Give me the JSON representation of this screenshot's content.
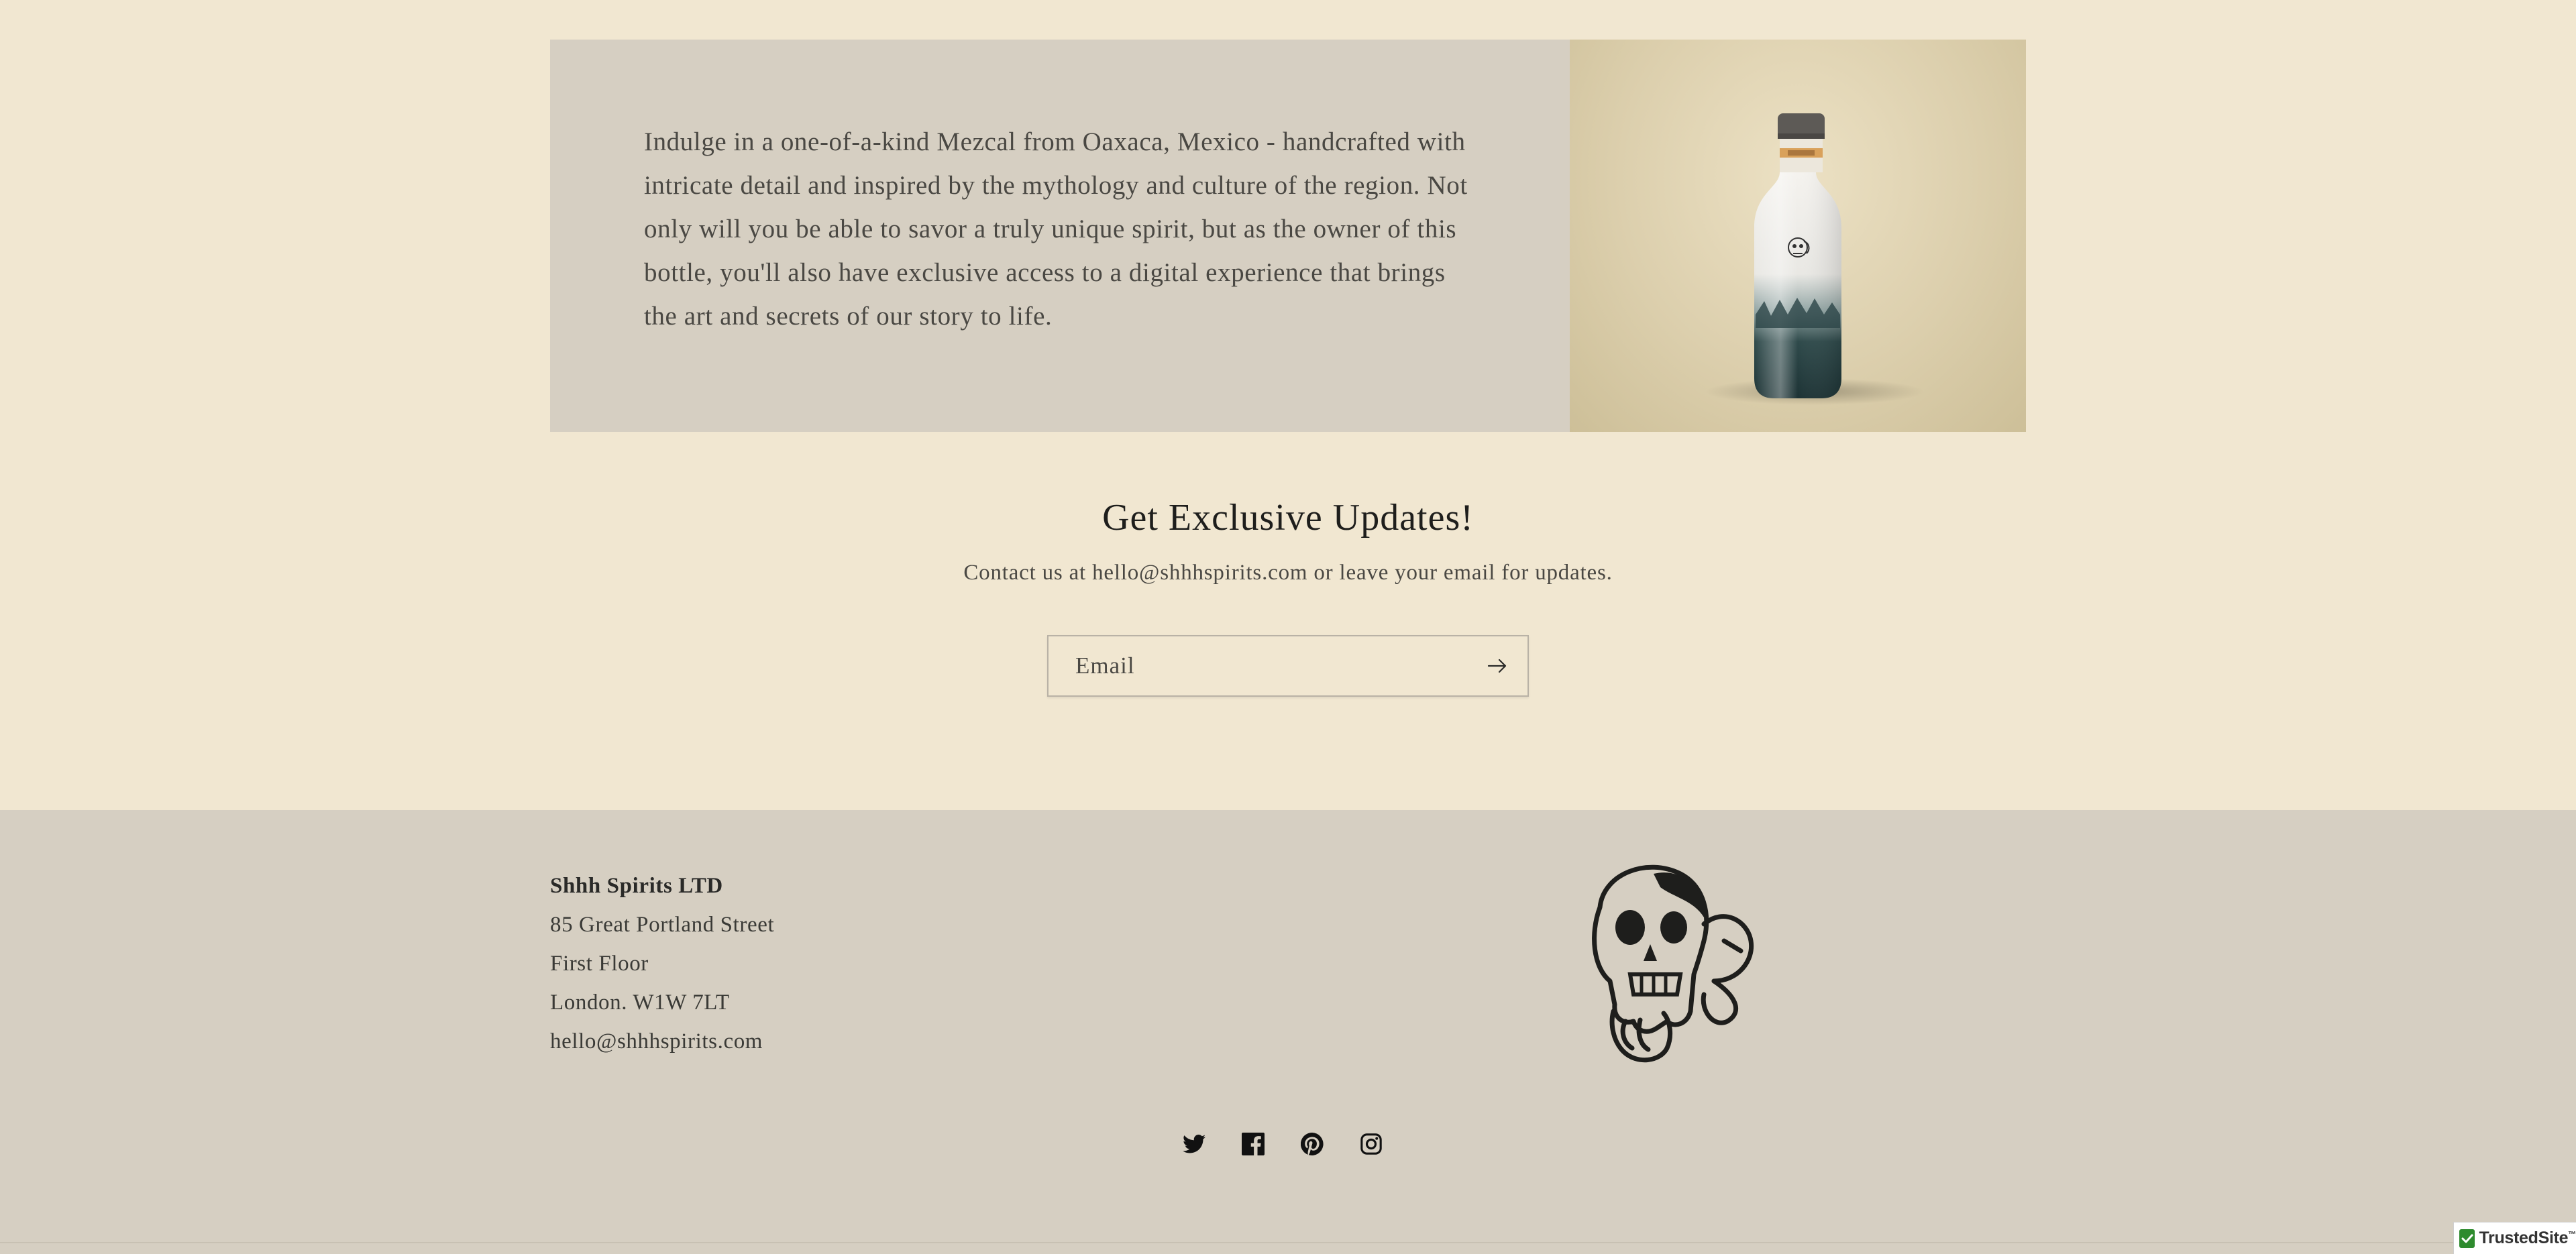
{
  "feature": {
    "text": "Indulge in a one-of-a-kind Mezcal from Oaxaca, Mexico - handcrafted with intricate detail and inspired by the mythology and culture of the region. Not only will you be able to savor a truly unique spirit, but as the owner of this bottle, you'll also have exclusive access to a digital experience that brings the art and secrets of our story to life.",
    "image_icon": "mezcal-bottle"
  },
  "newsletter": {
    "title": "Get Exclusive Updates!",
    "subtitle": "Contact us at hello@shhhspirits.com or leave your email for updates.",
    "email_placeholder": "Email",
    "submit_icon": "arrow-right-icon"
  },
  "footer": {
    "company": "Shhh Spirits LTD",
    "address_line1": "85 Great Portland Street",
    "address_line2": "First Floor",
    "address_line3": "London. W1W 7LT",
    "email": "hello@shhhspirits.com",
    "logo_icon": "skull-logo",
    "socials": [
      "twitter-icon",
      "facebook-icon",
      "pinterest-icon",
      "instagram-icon"
    ]
  },
  "badge": {
    "label": "TrustedSite",
    "mark": "™"
  },
  "colors": {
    "page_bg": "#f1e7d1",
    "panel_bg": "#d6cfc2",
    "text": "#3a3a36",
    "heading": "#1e1e1c",
    "badge_green": "#2e8b2e"
  }
}
